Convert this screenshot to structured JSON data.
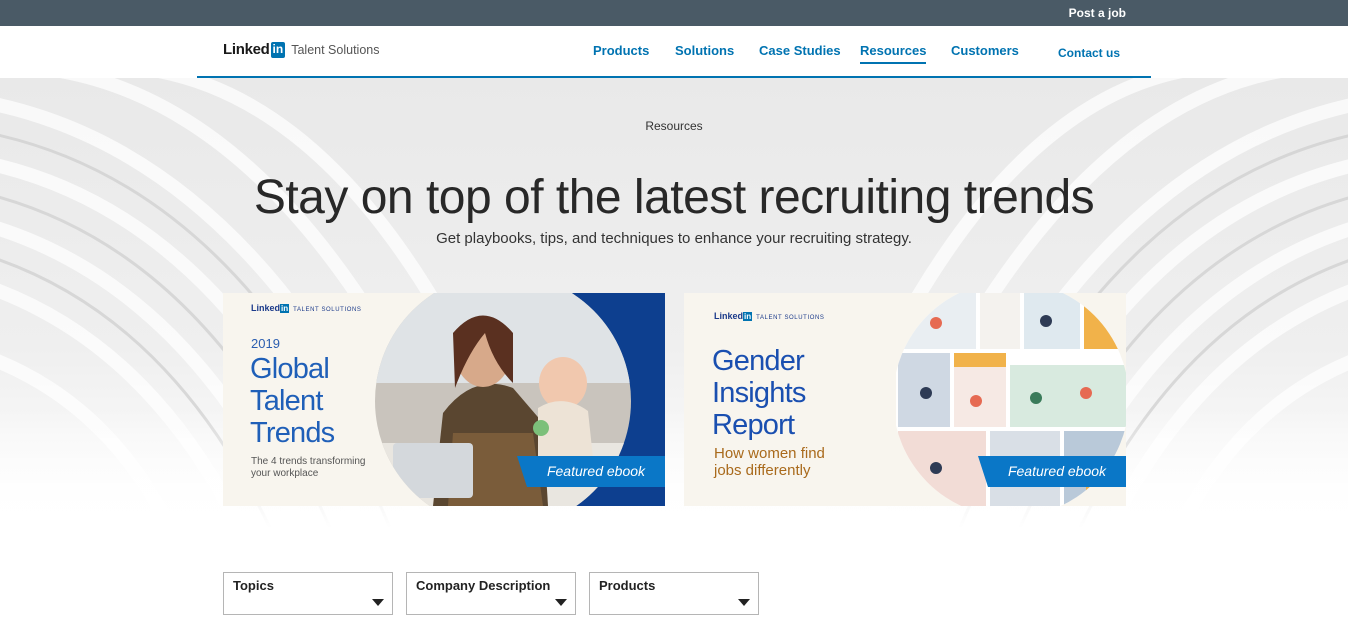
{
  "topbar": {
    "post_job": "Post a job"
  },
  "logo": {
    "wordmark": "Linked",
    "in": "in",
    "product": "Talent Solutions"
  },
  "nav": {
    "items": [
      {
        "label": "Products"
      },
      {
        "label": "Solutions"
      },
      {
        "label": "Case Studies"
      },
      {
        "label": "Resources",
        "active": true
      },
      {
        "label": "Customers"
      },
      {
        "label": "Contact us"
      }
    ]
  },
  "hero": {
    "breadcrumb": "Resources",
    "headline": "Stay on top of the latest recruiting trends",
    "subhead": "Get playbooks, tips, and techniques to enhance your recruiting strategy."
  },
  "cards": [
    {
      "brand": "Linked",
      "brand_in": "in",
      "brand_suffix": "TALENT SOLUTIONS",
      "year": "2019",
      "title_lines": [
        "Global",
        "Talent",
        "Trends"
      ],
      "caption": "The 4 trends transforming your workplace",
      "badge": "Featured ebook"
    },
    {
      "brand": "Linked",
      "brand_in": "in",
      "brand_suffix": "TALENT SOLUTIONS",
      "title_lines": [
        "Gender",
        "Insights",
        "Report"
      ],
      "caption": "How women find jobs differently",
      "badge": "Featured ebook"
    }
  ],
  "filters": [
    {
      "label": "Topics"
    },
    {
      "label": "Company Description"
    },
    {
      "label": "Products"
    }
  ],
  "colors": {
    "topbar": "#4a5a66",
    "accent": "#0073b1",
    "badge": "#0a77c7",
    "title_blue": "#1f5fb8",
    "caption_orange": "#a96a1c"
  }
}
